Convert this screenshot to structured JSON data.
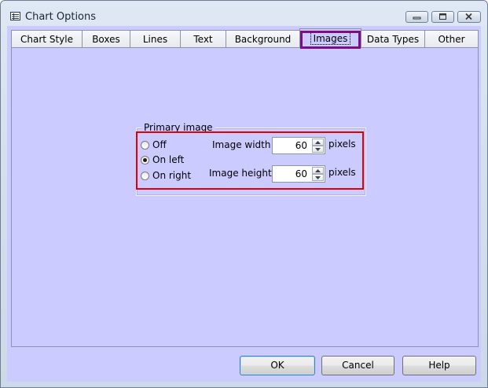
{
  "window": {
    "title": "Chart Options"
  },
  "tabs": [
    {
      "label": "Chart Style"
    },
    {
      "label": "Boxes"
    },
    {
      "label": "Lines"
    },
    {
      "label": "Text"
    },
    {
      "label": "Background"
    },
    {
      "label": "Images",
      "active": true
    },
    {
      "label": "Data Types"
    },
    {
      "label": "Other"
    }
  ],
  "primary_image": {
    "group_label": "Primary image",
    "options": [
      {
        "label": "Off",
        "selected": false
      },
      {
        "label": "On left",
        "selected": true
      },
      {
        "label": "On right",
        "selected": false
      }
    ],
    "width": {
      "label": "Image width :",
      "value": "60",
      "unit": "pixels"
    },
    "height": {
      "label": "Image height :",
      "value": "60",
      "unit": "pixels"
    }
  },
  "buttons": {
    "ok": "OK",
    "cancel": "Cancel",
    "help": "Help"
  },
  "colors": {
    "panel": "#cccbff",
    "tab_highlight": "#7b0f86",
    "group_highlight": "#e00000"
  }
}
